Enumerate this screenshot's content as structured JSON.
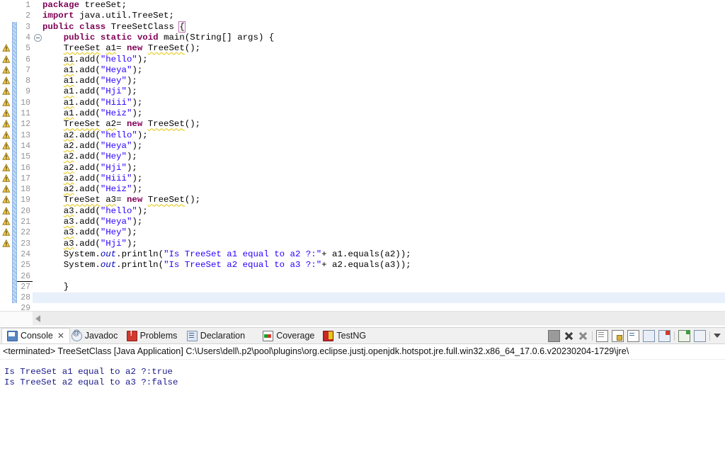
{
  "editor": {
    "name": "java-source-editor",
    "current_line": 28,
    "change_bar_from": 3,
    "change_bar_to": 28,
    "warning_lines": [
      5,
      6,
      7,
      8,
      9,
      10,
      11,
      12,
      13,
      14,
      15,
      16,
      17,
      18,
      19,
      20,
      21,
      22,
      23
    ],
    "folding_lines": [
      4
    ],
    "lines": [
      {
        "n": "1",
        "text": "package treeSet;"
      },
      {
        "n": "2",
        "text": "import java.util.TreeSet;"
      },
      {
        "n": "3",
        "text": "public class TreeSetClass {"
      },
      {
        "n": "4",
        "text": "    public static void main(String[] args) {"
      },
      {
        "n": "5",
        "text": "    TreeSet a1= new TreeSet();"
      },
      {
        "n": "6",
        "text": "    a1.add(\"hello\");"
      },
      {
        "n": "7",
        "text": "    a1.add(\"Heya\");"
      },
      {
        "n": "8",
        "text": "    a1.add(\"Hey\");"
      },
      {
        "n": "9",
        "text": "    a1.add(\"Hji\");"
      },
      {
        "n": "10",
        "text": "    a1.add(\"Hiii\");"
      },
      {
        "n": "11",
        "text": "    a1.add(\"Heiz\");"
      },
      {
        "n": "12",
        "text": "    TreeSet a2= new TreeSet();"
      },
      {
        "n": "13",
        "text": "    a2.add(\"hello\");"
      },
      {
        "n": "14",
        "text": "    a2.add(\"Heya\");"
      },
      {
        "n": "15",
        "text": "    a2.add(\"Hey\");"
      },
      {
        "n": "16",
        "text": "    a2.add(\"Hji\");"
      },
      {
        "n": "17",
        "text": "    a2.add(\"Hiii\");"
      },
      {
        "n": "18",
        "text": "    a2.add(\"Heiz\");"
      },
      {
        "n": "19",
        "text": "    TreeSet a3= new TreeSet();"
      },
      {
        "n": "20",
        "text": "    a3.add(\"hello\");"
      },
      {
        "n": "21",
        "text": "    a3.add(\"Heya\");"
      },
      {
        "n": "22",
        "text": "    a3.add(\"Hey\");"
      },
      {
        "n": "23",
        "text": "    a3.add(\"Hji\");"
      },
      {
        "n": "24",
        "text": "    System.out.println(\"Is TreeSet a1 equal to a2 ?:\"+ a1.equals(a2));"
      },
      {
        "n": "25",
        "text": "    System.out.println(\"Is TreeSet a2 equal to a3 ?:\"+ a2.equals(a3));"
      },
      {
        "n": "26",
        "text": ""
      },
      {
        "n": "27",
        "text": "    }"
      },
      {
        "n": "28",
        "text": "}"
      },
      {
        "n": "29",
        "text": ""
      }
    ]
  },
  "console_panel": {
    "tabs": [
      {
        "label": "Console",
        "icon": "console-monitor-icon",
        "active": true,
        "closable": true
      },
      {
        "label": "Javadoc",
        "icon": "javadoc-at-icon",
        "active": false,
        "closable": false
      },
      {
        "label": "Problems",
        "icon": "problems-error-icon",
        "active": false,
        "closable": false
      },
      {
        "label": "Declaration",
        "icon": "declaration-icon",
        "active": false,
        "closable": false
      },
      {
        "label": "Coverage",
        "icon": "coverage-icon",
        "active": false,
        "closable": false
      },
      {
        "label": "TestNG",
        "icon": "testng-icon",
        "active": false,
        "closable": false
      }
    ],
    "toolbar": [
      {
        "name": "terminate-button",
        "icon": "stop-square-icon"
      },
      {
        "name": "remove-launch-button",
        "icon": "remove-x-icon"
      },
      {
        "name": "remove-all-launches-button",
        "icon": "remove-all-xx-icon"
      },
      {
        "name": "clear-console-button",
        "icon": "clear-console-icon"
      },
      {
        "name": "scroll-lock-button",
        "icon": "scroll-lock-icon"
      },
      {
        "name": "word-wrap-button",
        "icon": "word-wrap-icon"
      },
      {
        "name": "show-console-stdout-button",
        "icon": "console-out-icon"
      },
      {
        "name": "show-console-stderr-button",
        "icon": "console-err-icon"
      },
      {
        "name": "open-console-button",
        "icon": "new-console-icon"
      },
      {
        "name": "display-selected-console-button",
        "icon": "display-console-icon"
      },
      {
        "name": "view-menu-button",
        "icon": "chevron-down-icon"
      }
    ],
    "terminated_line": "<terminated> TreeSetClass [Java Application] C:\\Users\\dell\\.p2\\pool\\plugins\\org.eclipse.justj.openjdk.hotspot.jre.full.win32.x86_64_17.0.6.v20230204-1729\\jre\\",
    "output": [
      "Is TreeSet a1 equal to a2 ?:true",
      "Is TreeSet a2 equal to a3 ?:false"
    ]
  },
  "colors": {
    "keyword": "#7f0055",
    "string": "#2a00ff",
    "static_field": "#0000c0",
    "current_line_bg": "#e8f0fb",
    "change_bar": "#9fc3ec",
    "warning_underline": "#e3c300",
    "console_text": "#1a1a8c",
    "line_number": "#949494"
  }
}
